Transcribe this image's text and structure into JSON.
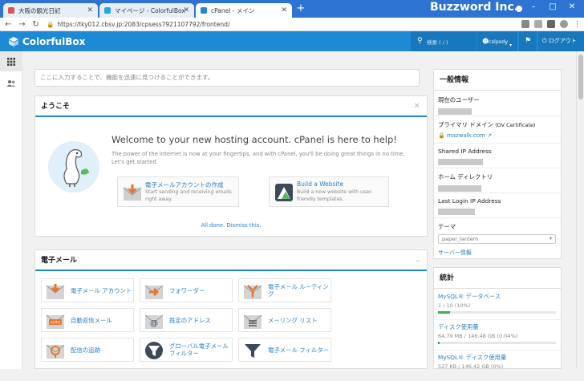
{
  "browser": {
    "tabs": [
      {
        "label": "大阪の観光日記",
        "active": false
      },
      {
        "label": "マイページ - ColorfulBox",
        "active": false
      },
      {
        "label": "cPanel - メイン",
        "active": true
      }
    ],
    "url": "https://tky012.cbsv.jp:2083/cpsess7921107792/frontend/",
    "watermark": "Buzzword Inc."
  },
  "header": {
    "brand": "ColorfulBox",
    "search_placeholder": "検索 ( / )",
    "user": "cslpsdy",
    "logout_label": "ログアウト"
  },
  "main": {
    "search_placeholder": "ここに入力することで、機能を迅速に見つけることができます。",
    "welcome": {
      "heading": "ようこそ",
      "title": "Welcome to your new hosting account. cPanel is here to help!",
      "text": "The power of the internet is now at your fingertips, and with cPanel, you'll be doing great things in no time. Let's get started.",
      "cards": [
        {
          "title": "電子メールアカウントの作成",
          "desc": "Start sending and receiving emails right away."
        },
        {
          "title": "Build a Website",
          "desc": "Build a new website with user-friendly templates."
        }
      ],
      "dismiss": "All done. Dismiss this."
    },
    "email": {
      "heading": "電子メール",
      "items": [
        {
          "label": "電子メール アカウント",
          "icon": "email-accounts-icon"
        },
        {
          "label": "フォワーダー",
          "icon": "forwarders-icon"
        },
        {
          "label": "電子メール ルーティング",
          "icon": "email-routing-icon"
        },
        {
          "label": "自動返信メール",
          "icon": "autoresponders-icon"
        },
        {
          "label": "既定のアドレス",
          "icon": "default-address-icon"
        },
        {
          "label": "メーリング リスト",
          "icon": "mailing-lists-icon"
        },
        {
          "label": "配信の追跡",
          "icon": "track-delivery-icon"
        },
        {
          "label": "グローバル電子メール フィルター",
          "icon": "global-filters-icon"
        },
        {
          "label": "電子メール フィルター",
          "icon": "email-filters-icon"
        }
      ]
    }
  },
  "general": {
    "heading": "一般情報",
    "current_user_label": "現在のユーザー",
    "primary_domain_label": "プライマリ ドメイン",
    "primary_domain_badge": "(DV Certificate)",
    "primary_domain": "mazwalk.com",
    "shared_ip_label": "Shared IP Address",
    "home_dir_label": "ホーム ディレクトリ",
    "last_login_label": "Last Login IP Address",
    "theme_label": "テーマ",
    "theme_value": "paper_lantern",
    "server_info_link": "サーバー情報"
  },
  "stats": {
    "heading": "統計",
    "rows": [
      {
        "label": "MySQL® データベース",
        "value": "1 / 10   (10%)",
        "fraction": 0.1
      },
      {
        "label": "ディスク使用量",
        "value": "64.79 MB / 146.48 GB   (0.04%)",
        "fraction": 0.0004
      },
      {
        "label": "MySQL® ディスク使用量",
        "value": "527 KB / 146.42 GB   (0%)",
        "fraction": 0
      }
    ]
  },
  "colors": {
    "brand_blue": "#1d8ad6",
    "link_blue": "#2a7fc4",
    "icon_orange": "#e8762b",
    "progress_green": "#36b24a"
  }
}
